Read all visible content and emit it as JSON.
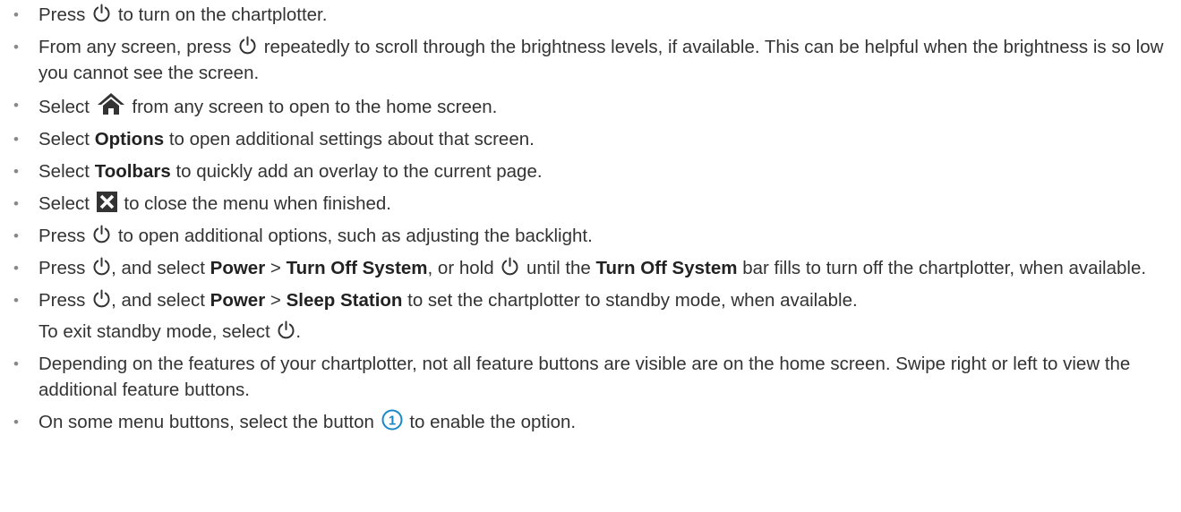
{
  "icons": {
    "power": "power-icon",
    "home": "home-icon",
    "close": "close-x-icon",
    "callout": "numbered-callout-1-icon"
  },
  "colors": {
    "text": "#333333",
    "accent_callout": "#1a87c8",
    "bullet": "#888888"
  },
  "items": [
    {
      "a": "Press",
      "b": "to turn on the chartplotter."
    },
    {
      "a": "From any screen, press",
      "b": "repeatedly to scroll through the brightness levels, if available. This can be helpful when the brightness is so low you cannot see the screen."
    },
    {
      "a": "Select",
      "b": "from any screen to open to the home screen."
    },
    {
      "a": "Select",
      "bold": "Options",
      "b": "to open additional settings about that screen."
    },
    {
      "a": "Select",
      "bold": "Toolbars",
      "b": "to quickly add an overlay to the current page."
    },
    {
      "a": "Select",
      "b": "to close the menu when finished."
    },
    {
      "a": "Press",
      "b": "to open additional options, such as adjusting the backlight."
    },
    {
      "a": "Press",
      "b": ", and select",
      "bold1": "Power",
      "sep": ">",
      "bold2": "Turn Off System",
      "c": ", or hold",
      "d": "until the",
      "bold3": "Turn Off System",
      "e": "bar fills to turn off the chartplotter, when available."
    },
    {
      "a": "Press",
      "b": ", and select",
      "bold1": "Power",
      "sep": ">",
      "bold2": "Sleep Station",
      "c": "to set the chartplotter to standby mode, when available.",
      "sub": "To exit standby mode, select",
      "sub_end": "."
    },
    {
      "a": "Depending on the features of your chartplotter, not all feature buttons are visible are on the home screen. Swipe right or left to view the additional feature buttons."
    },
    {
      "a": "On some menu buttons, select the button",
      "callout": "1",
      "b": "to enable the option."
    }
  ]
}
